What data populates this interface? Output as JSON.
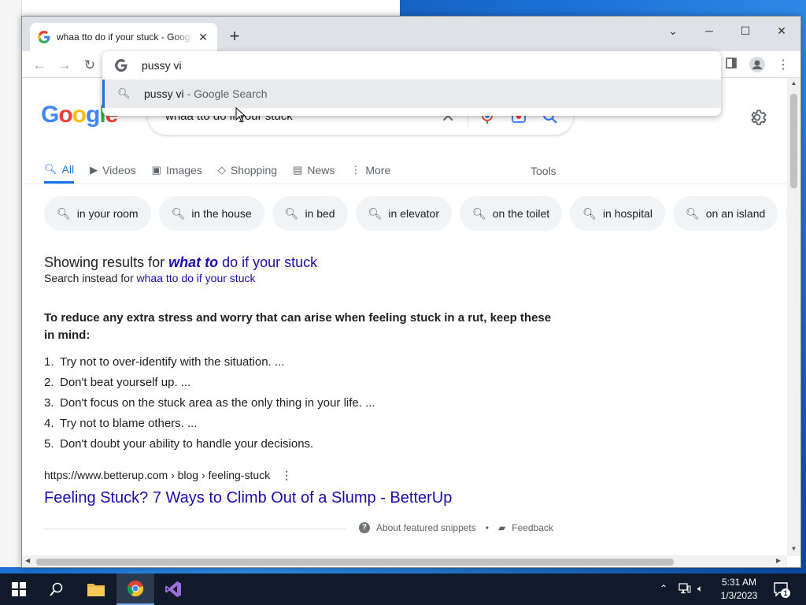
{
  "browser": {
    "tab_title": "whaa tto do if your stuck - Google Search",
    "new_tab": "+",
    "omnibox_value": "pussy vi",
    "suggestion_query": "pussy vi",
    "suggestion_suffix": "- Google Search"
  },
  "search": {
    "logo": "Google",
    "query": "whaa tto do if your stuck",
    "tabs": [
      {
        "label": "All",
        "icon": "search-icon"
      },
      {
        "label": "Videos",
        "icon": "video-icon"
      },
      {
        "label": "Images",
        "icon": "image-icon"
      },
      {
        "label": "Shopping",
        "icon": "tag-icon"
      },
      {
        "label": "News",
        "icon": "news-icon"
      },
      {
        "label": "More",
        "icon": "kebab-icon"
      }
    ],
    "tools": "Tools",
    "chips": [
      "in your room",
      "in the house",
      "in bed",
      "in elevator",
      "on the toilet",
      "in hospital",
      "on an island"
    ],
    "showing_prefix": "Showing results for ",
    "showing_bold": "what to",
    "showing_rest": " do if your stuck",
    "instead_prefix": "Search instead for ",
    "instead_link": "whaa tto do if your stuck"
  },
  "snippet": {
    "heading": "To reduce any extra stress and worry that can arise when feeling stuck in a rut, keep these in mind:",
    "items": [
      {
        "num": "1.",
        "text": "Try not to over-identify with the situation. ..."
      },
      {
        "num": "2.",
        "text": "Don't beat yourself up. ..."
      },
      {
        "num": "3.",
        "text": "Don't focus on the stuck area as the only thing in your life. ..."
      },
      {
        "num": "4.",
        "text": "Try not to blame others. ..."
      },
      {
        "num": "5.",
        "text": "Don't doubt your ability to handle your decisions."
      }
    ],
    "cite": "https://www.betterup.com › blog › feeling-stuck",
    "title": "Feeling Stuck? 7 Ways to Climb Out of a Slump - BetterUp",
    "about": "About featured snippets",
    "bullet": "•",
    "feedback": "Feedback"
  },
  "taskbar": {
    "time": "5:31 AM",
    "date": "1/3/2023",
    "notifications": "1"
  },
  "colors": {
    "accent": "#1a73e8",
    "link": "#1a0dab"
  }
}
